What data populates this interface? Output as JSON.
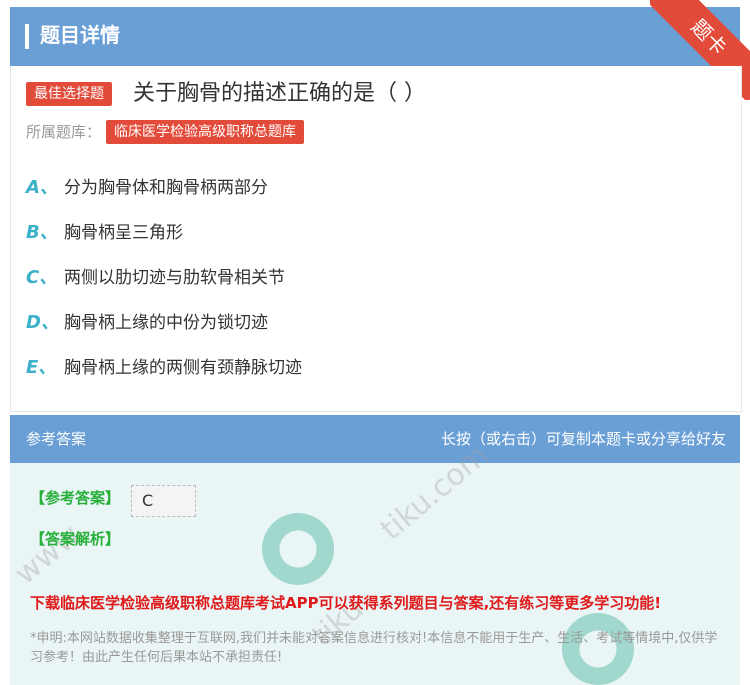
{
  "header": {
    "title": "题目详情"
  },
  "corner_badge": "题卡",
  "question": {
    "type_tag": "最佳选择题",
    "title": "关于胸骨的描述正确的是（ ）",
    "library_label": "所属题库：",
    "library_name": "临床医学检验高级职称总题库"
  },
  "options": [
    {
      "letter": "A、",
      "text": "分为胸骨体和胸骨柄两部分"
    },
    {
      "letter": "B、",
      "text": "胸骨柄呈三角形"
    },
    {
      "letter": "C、",
      "text": "两侧以肋切迹与肋软骨相关节"
    },
    {
      "letter": "D、",
      "text": "胸骨柄上缘的中份为锁切迹"
    },
    {
      "letter": "E、",
      "text": "胸骨柄上缘的两侧有颈静脉切迹"
    }
  ],
  "answer": {
    "header_left": "参考答案",
    "header_right": "长按（或右击）可复制本题卡或分享给好友",
    "answer_label": "【参考答案】",
    "answer_value": "C",
    "analysis_label": "【答案解析】",
    "promo": "下载临床医学检验高级职称总题库考试APP可以获得系列题目与答案,还有练习等更多学习功能!",
    "disclaimer": "*申明:本网站数据收集整理于互联网,我们并未能对答案信息进行核对!本信息不能用于生产、生活、考试等情境中,仅供学习参考！由此产生任何后果本站不承担责任!"
  },
  "colors": {
    "header_bg": "#6a9fd6",
    "tag_red": "#e24a3a",
    "option_letter": "#3bb1c9",
    "answer_green": "#27b03a",
    "promo_red": "#e0191b"
  }
}
